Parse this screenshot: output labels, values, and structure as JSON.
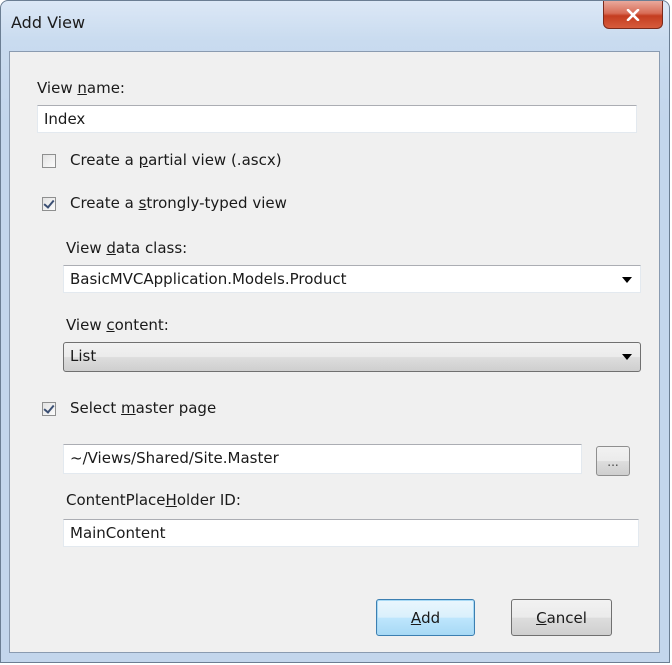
{
  "dialog": {
    "title": "Add View",
    "close_symbol": "✕"
  },
  "view_name": {
    "label_pre": "View ",
    "label_accel": "n",
    "label_post": "ame:",
    "value": "Index"
  },
  "partial_view": {
    "label_pre": "Create a ",
    "label_accel": "p",
    "label_post": "artial view (.ascx)",
    "checked": false
  },
  "strongly_typed": {
    "label_pre": "Create a ",
    "label_accel": "s",
    "label_post": "trongly-typed view",
    "checked": true
  },
  "view_data_class": {
    "label_pre": "View ",
    "label_accel": "d",
    "label_post": "ata class:",
    "value": "BasicMVCApplication.Models.Product"
  },
  "view_content": {
    "label_pre": "View ",
    "label_accel": "c",
    "label_post": "ontent:",
    "value": "List"
  },
  "master_page": {
    "label_pre": "Select ",
    "label_accel": "m",
    "label_post": "aster page",
    "checked": true,
    "path": "~/Views/Shared/Site.Master",
    "browse_label": "..."
  },
  "content_placeholder": {
    "label_pre": "ContentPlace",
    "label_accel": "H",
    "label_post": "older ID:",
    "value": "MainContent"
  },
  "buttons": {
    "add_accel": "A",
    "add_rest": "dd",
    "cancel_accel": "C",
    "cancel_rest": "ancel"
  },
  "colors": {
    "title_bar": "#c9dbef",
    "client_bg": "#f0f0f0",
    "close_button": "#c43d20",
    "default_button_border": "#3c7fb1"
  }
}
